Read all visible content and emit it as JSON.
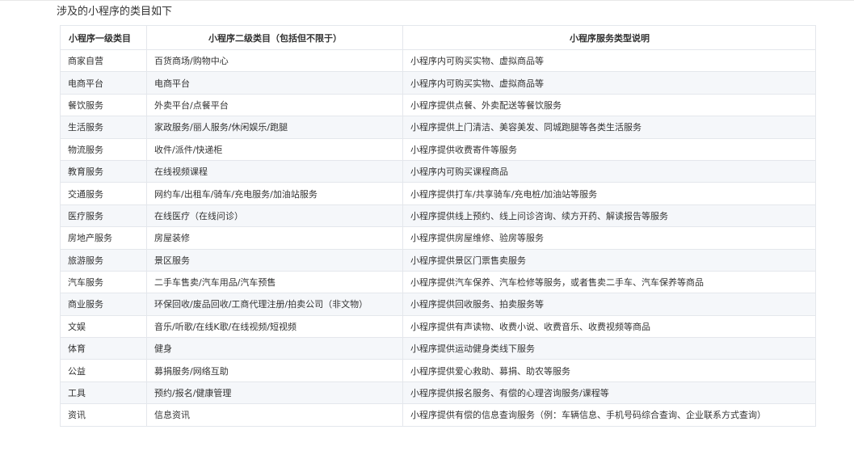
{
  "intro": "涉及的小程序的类目如下",
  "table": {
    "headers": [
      "小程序一级类目",
      "小程序二级类目（包括但不限于）",
      "小程序服务类型说明"
    ],
    "rows": [
      [
        "商家自营",
        "百货商场/购物中心",
        "小程序内可购买实物、虚拟商品等"
      ],
      [
        "电商平台",
        "电商平台",
        "小程序内可购买实物、虚拟商品等"
      ],
      [
        "餐饮服务",
        "外卖平台/点餐平台",
        "小程序提供点餐、外卖配送等餐饮服务"
      ],
      [
        "生活服务",
        "家政服务/丽人服务/休闲娱乐/跑腿",
        "小程序提供上门清洁、美容美发、同城跑腿等各类生活服务"
      ],
      [
        "物流服务",
        "收件/派件/快递柜",
        "小程序提供收费寄件等服务"
      ],
      [
        "教育服务",
        "在线视频课程",
        "小程序内可购买课程商品"
      ],
      [
        "交通服务",
        "网约车/出租车/骑车/充电服务/加油站服务",
        "小程序提供打车/共享骑车/充电桩/加油站等服务"
      ],
      [
        "医疗服务",
        "在线医疗（在线问诊）",
        "小程序提供线上预约、线上问诊咨询、续方开药、解读报告等服务"
      ],
      [
        "房地产服务",
        "房屋装修",
        "小程序提供房屋维修、验房等服务"
      ],
      [
        "旅游服务",
        "景区服务",
        "小程序提供景区门票售卖服务"
      ],
      [
        "汽车服务",
        "二手车售卖/汽车用品/汽车预售",
        "小程序提供汽车保养、汽车检修等服务，或者售卖二手车、汽车保养等商品"
      ],
      [
        "商业服务",
        "环保回收/废品回收/工商代理注册/拍卖公司（非文物）",
        "小程序提供回收服务、拍卖服务等"
      ],
      [
        "文娱",
        "音乐/听歌/在线K歌/在线视频/短视频",
        "小程序提供有声读物、收费小说、收费音乐、收费视频等商品"
      ],
      [
        "体育",
        "健身",
        "小程序提供运动健身类线下服务"
      ],
      [
        "公益",
        "募捐服务/网络互助",
        "小程序提供爱心救助、募捐、助农等服务"
      ],
      [
        "工具",
        "预约/报名/健康管理",
        "小程序提供报名服务、有偿的心理咨询服务/课程等"
      ],
      [
        "资讯",
        "信息资讯",
        "小程序提供有偿的信息查询服务（例：车辆信息、手机号码综合查询、企业联系方式查询）"
      ]
    ]
  }
}
